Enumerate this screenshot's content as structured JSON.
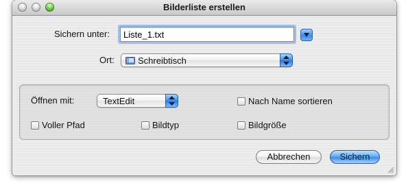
{
  "window": {
    "title": "Bilderliste erstellen"
  },
  "save": {
    "label": "Sichern unter:",
    "filename": "Liste_1.txt"
  },
  "location": {
    "label": "Ort:",
    "selected": "Schreibtisch",
    "icon": "desktop-folder-icon"
  },
  "options": {
    "open_with_label": "Öffnen mit:",
    "open_with_selected": "TextEdit",
    "sort_by_name": {
      "label": "Nach Name sortieren",
      "checked": false
    },
    "full_path": {
      "label": "Voller Pfad",
      "checked": false
    },
    "image_type": {
      "label": "Bildtyp",
      "checked": false
    },
    "image_size": {
      "label": "Bildgröße",
      "checked": false
    }
  },
  "buttons": {
    "cancel": "Abbrechen",
    "save": "Sichern"
  },
  "colors": {
    "accent": "#3a8ae6",
    "focus_ring": "#9dbfe8"
  }
}
